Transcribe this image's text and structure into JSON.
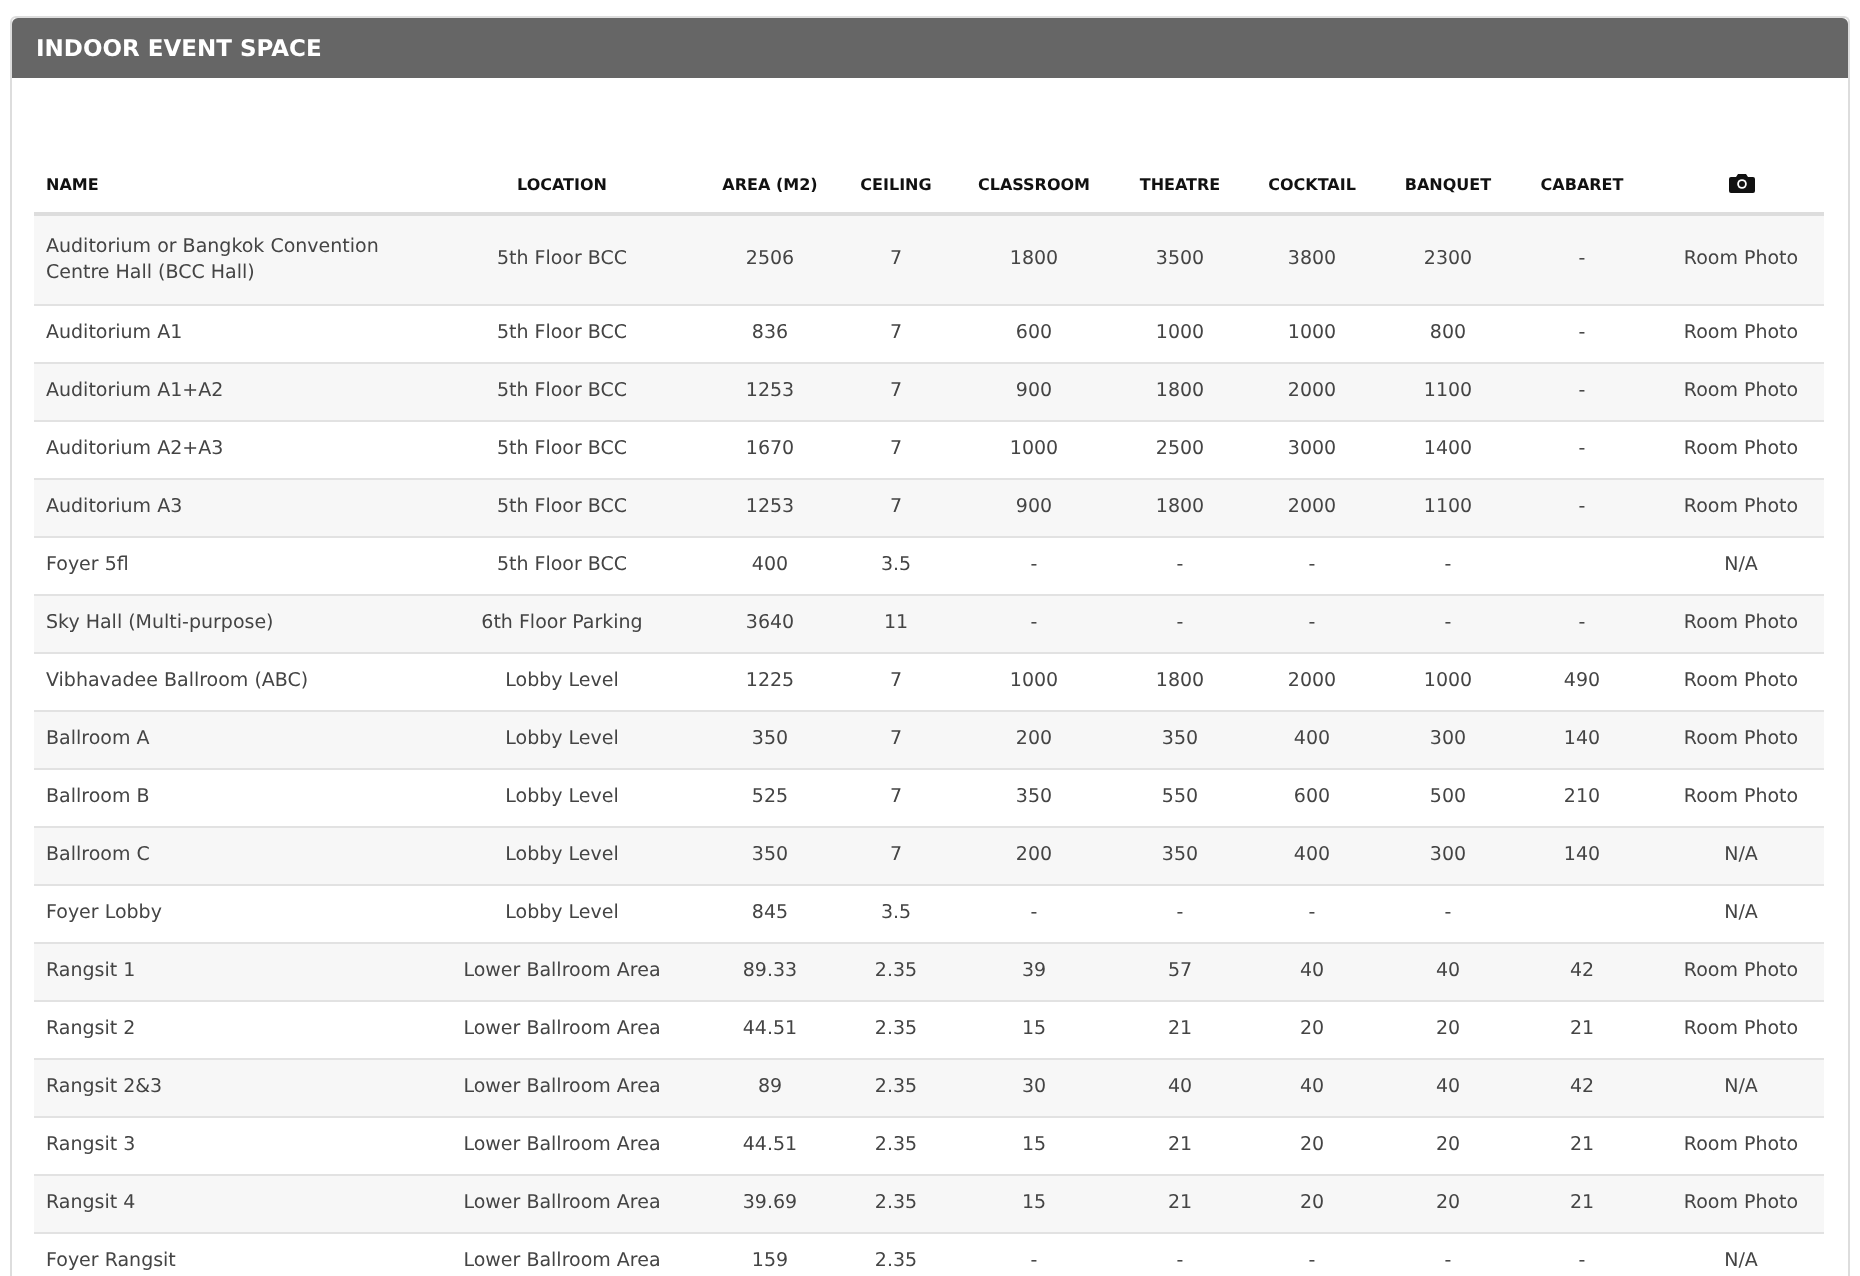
{
  "panel": {
    "title": "INDOOR EVENT SPACE"
  },
  "table": {
    "columns": [
      "NAME",
      "LOCATION",
      "AREA (M2)",
      "CEILING",
      "CLASSROOM",
      "THEATRE",
      "COCKTAIL",
      "BANQUET",
      "CABARET"
    ],
    "rows": [
      {
        "name": "Auditorium or Bangkok Convention Centre Hall (BCC Hall)",
        "location": "5th Floor BCC",
        "area": "2506",
        "ceiling": "7",
        "classroom": "1800",
        "theatre": "3500",
        "cocktail": "3800",
        "banquet": "2300",
        "cabaret": "-",
        "photo": "Room Photo"
      },
      {
        "name": "Auditorium A1",
        "location": "5th Floor BCC",
        "area": "836",
        "ceiling": "7",
        "classroom": "600",
        "theatre": "1000",
        "cocktail": "1000",
        "banquet": "800",
        "cabaret": "-",
        "photo": "Room Photo"
      },
      {
        "name": "Auditorium A1+A2",
        "location": "5th Floor BCC",
        "area": "1253",
        "ceiling": "7",
        "classroom": "900",
        "theatre": "1800",
        "cocktail": "2000",
        "banquet": "1100",
        "cabaret": "-",
        "photo": "Room Photo"
      },
      {
        "name": "Auditorium A2+A3",
        "location": "5th Floor BCC",
        "area": "1670",
        "ceiling": "7",
        "classroom": "1000",
        "theatre": "2500",
        "cocktail": "3000",
        "banquet": "1400",
        "cabaret": "-",
        "photo": "Room Photo"
      },
      {
        "name": "Auditorium A3",
        "location": "5th Floor BCC",
        "area": "1253",
        "ceiling": "7",
        "classroom": "900",
        "theatre": "1800",
        "cocktail": "2000",
        "banquet": "1100",
        "cabaret": "-",
        "photo": "Room Photo"
      },
      {
        "name": "Foyer 5fl",
        "location": "5th Floor BCC",
        "area": "400",
        "ceiling": "3.5",
        "classroom": "-",
        "theatre": "-",
        "cocktail": "-",
        "banquet": "-",
        "photo": "N/A"
      },
      {
        "name": "Sky Hall (Multi-purpose)",
        "location": "6th Floor Parking",
        "area": "3640",
        "ceiling": "11",
        "classroom": "-",
        "theatre": "-",
        "cocktail": "-",
        "banquet": "-",
        "cabaret": "-",
        "photo": "Room Photo"
      },
      {
        "name": "Vibhavadee Ballroom (ABC)",
        "location": "Lobby Level",
        "area": "1225",
        "ceiling": "7",
        "classroom": "1000",
        "theatre": "1800",
        "cocktail": "2000",
        "banquet": "1000",
        "cabaret": "490",
        "photo": "Room Photo"
      },
      {
        "name": "Ballroom A",
        "location": "Lobby Level",
        "area": "350",
        "ceiling": "7",
        "classroom": "200",
        "theatre": "350",
        "cocktail": "400",
        "banquet": "300",
        "cabaret": "140",
        "photo": "Room Photo"
      },
      {
        "name": "Ballroom B",
        "location": "Lobby Level",
        "area": "525",
        "ceiling": "7",
        "classroom": "350",
        "theatre": "550",
        "cocktail": "600",
        "banquet": "500",
        "cabaret": "210",
        "photo": "Room Photo"
      },
      {
        "name": "Ballroom C",
        "location": "Lobby Level",
        "area": "350",
        "ceiling": "7",
        "classroom": "200",
        "theatre": "350",
        "cocktail": "400",
        "banquet": "300",
        "cabaret": "140",
        "photo": "N/A"
      },
      {
        "name": "Foyer Lobby",
        "location": "Lobby Level",
        "area": "845",
        "ceiling": "3.5",
        "classroom": "-",
        "theatre": "-",
        "cocktail": "-",
        "banquet": "-",
        "photo": "N/A"
      },
      {
        "name": "Rangsit 1",
        "location": "Lower Ballroom Area",
        "area": "89.33",
        "ceiling": "2.35",
        "classroom": "39",
        "theatre": "57",
        "cocktail": "40",
        "banquet": "40",
        "cabaret": "42",
        "photo": "Room Photo"
      },
      {
        "name": "Rangsit 2",
        "location": "Lower Ballroom Area",
        "area": "44.51",
        "ceiling": "2.35",
        "classroom": "15",
        "theatre": "21",
        "cocktail": "20",
        "banquet": "20",
        "cabaret": "21",
        "photo": "Room Photo"
      },
      {
        "name": "Rangsit 2&3",
        "location": "Lower Ballroom Area",
        "area": "89",
        "ceiling": "2.35",
        "classroom": "30",
        "theatre": "40",
        "cocktail": "40",
        "banquet": "40",
        "cabaret": "42",
        "photo": "N/A"
      },
      {
        "name": "Rangsit 3",
        "location": "Lower Ballroom Area",
        "area": "44.51",
        "ceiling": "2.35",
        "classroom": "15",
        "theatre": "21",
        "cocktail": "20",
        "banquet": "20",
        "cabaret": "21",
        "photo": "Room Photo"
      },
      {
        "name": "Rangsit 4",
        "location": "Lower Ballroom Area",
        "area": "39.69",
        "ceiling": "2.35",
        "classroom": "15",
        "theatre": "21",
        "cocktail": "20",
        "banquet": "20",
        "cabaret": "21",
        "photo": "Room Photo"
      },
      {
        "name": "Foyer Rangsit",
        "location": "Lower Ballroom Area",
        "area": "159",
        "ceiling": "2.35",
        "classroom": "-",
        "theatre": "-",
        "cocktail": "-",
        "banquet": "-",
        "cabaret": "-",
        "photo": "N/A"
      }
    ]
  }
}
